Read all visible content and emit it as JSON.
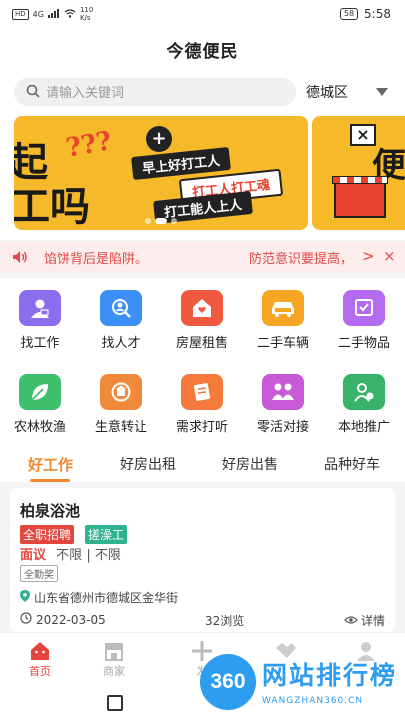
{
  "status_bar": {
    "hd": "HD",
    "signal": "4G",
    "net_speed": "110",
    "net_unit": "K/s",
    "battery": "58",
    "time": "5:58"
  },
  "header": {
    "title": "今德便民"
  },
  "search": {
    "placeholder": "请输入关键词",
    "district": "德城区"
  },
  "banner": {
    "big_text_1": "起",
    "big_text_2": "工吗",
    "question_marks": "???",
    "line1": "早上好打工人",
    "line2": "打工人打工魂",
    "line3": "打工能人上人",
    "next_slide_char": "便",
    "slide_count": 3,
    "active_slide": 2
  },
  "notice": {
    "text_1": "馅饼背后是陷阱。",
    "text_2": "防范意识要提高，",
    "arrow": ">",
    "close": "×"
  },
  "categories": [
    {
      "label": "找工作",
      "icon": "job-seeker-icon",
      "color": "#8b6ef0"
    },
    {
      "label": "找人才",
      "icon": "talent-search-icon",
      "color": "#3b8ff5"
    },
    {
      "label": "房屋租售",
      "icon": "house-heart-icon",
      "color": "#f0583f"
    },
    {
      "label": "二手车辆",
      "icon": "car-icon",
      "color": "#f6a623"
    },
    {
      "label": "二手物品",
      "icon": "cart-icon",
      "color": "#b46bf2"
    },
    {
      "label": "农林牧渔",
      "icon": "leaf-icon",
      "color": "#3dbf6b"
    },
    {
      "label": "生意转让",
      "icon": "shop-transfer-icon",
      "color": "#f08a3a"
    },
    {
      "label": "需求打听",
      "icon": "inquiry-icon",
      "color": "#f37a3a"
    },
    {
      "label": "零活对接",
      "icon": "people-icon",
      "color": "#c85ad8"
    },
    {
      "label": "本地推广",
      "icon": "promote-icon",
      "color": "#39b36a"
    }
  ],
  "tabs": [
    "好工作",
    "好房出租",
    "好房出售",
    "品种好车"
  ],
  "listing": {
    "title": "柏泉浴池",
    "tag_1": "全职招聘",
    "tag_2": "搓澡工",
    "salary": "面议",
    "experience": "不限",
    "education": "不限",
    "separator": "|",
    "welfare": "全勤奖",
    "address": "山东省德州市德城区金华街",
    "date": "2022-03-05",
    "views": "32浏览",
    "detail": "详情"
  },
  "bottom_nav": [
    {
      "label": "首页",
      "icon": "home-icon",
      "active": true
    },
    {
      "label": "商家",
      "icon": "store-icon",
      "active": false
    },
    {
      "label": "发",
      "icon": "plus-icon",
      "active": false
    },
    {
      "label": "",
      "icon": "handshake-icon",
      "active": false
    },
    {
      "label": "",
      "icon": "user-icon",
      "active": false
    }
  ],
  "watermark": {
    "circle": "360",
    "title": "网站排行榜",
    "sub": "WANGZHAN360.CN"
  },
  "colors": {
    "accent": "#f0892c",
    "red": "#e4453c",
    "notice_bg": "#fdecec",
    "banner_yellow": "#f6b92a",
    "watermark_blue": "#2d9df0"
  }
}
